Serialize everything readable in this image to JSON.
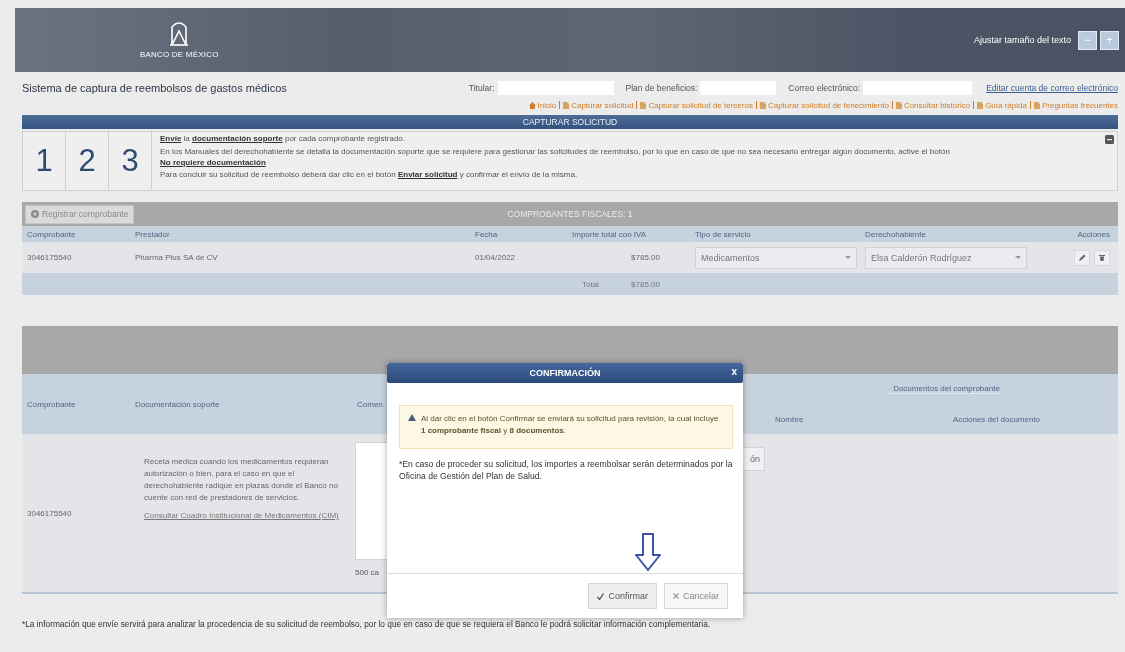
{
  "header": {
    "logo_text": "BANCO DE MÉXICO",
    "text_size_label": "Ajustar tamaño del texto",
    "text_size_buttons": [
      "−",
      "+"
    ]
  },
  "app_title": "Sistema de captura de reembolsos de gastos médicos",
  "fields": [
    {
      "label": "Titular:"
    },
    {
      "label": "Plan de beneficios:"
    },
    {
      "label": "Correo electrónico:"
    }
  ],
  "edit_email_link": "Editar cuenta de correo electrónico",
  "nav": [
    "Inicio",
    "Capturar solicitud",
    "Capturar solicitud de terceros",
    "Capturar solicitud de fenecimiento",
    "Consultar histórico",
    "Guía rápida",
    "Preguntas frecuentes"
  ],
  "section_title": "CAPTURAR SOLICITUD",
  "steps": {
    "numbers": [
      "1",
      "2",
      "3"
    ],
    "lines": [
      [
        {
          "text": "Envíe",
          "link": true
        },
        {
          "text": " la ",
          "link": false
        },
        {
          "text": "documentación soporte",
          "link": true
        },
        {
          "text": " por cada comprobante registrado.",
          "link": false
        }
      ],
      [
        {
          "text": "En los Manuales del derechohabiente se detalla la documentación soporte que se requiere para gestionar las solicitudes de reembolso, por lo que en caso de que no sea necesario entregar algún documento, active el botón ",
          "link": false
        },
        {
          "text": "No requiere documentación",
          "link": true
        }
      ],
      [
        {
          "text": "Para concluir su solicitud de reembolso deberá dar clic en el botón ",
          "link": false
        },
        {
          "text": "Enviar solicitud",
          "link": true
        },
        {
          "text": " y confirmar el envío de la misma.",
          "link": false
        }
      ]
    ]
  },
  "receipts": {
    "add_button": "Registrar comprobante",
    "title": "COMPROBANTES FISCALES: 1",
    "columns": [
      "Comprobante",
      "Prestador",
      "Fecha",
      "Importe total con IVA",
      "Tipo de servicio",
      "Derechohabiente",
      "Acciones"
    ],
    "rows": [
      {
        "receipt": "3046175540",
        "provider": "Pharma Plus SA de CV",
        "date": "01/04/2022",
        "amount": "$785.00",
        "service_type": "Medicamentos",
        "beneficiary": "Elsa Calderón Rodríguez"
      }
    ],
    "total_label": "Total",
    "total": "$785.00"
  },
  "documents": {
    "columns": [
      "Comprobante",
      "Documentación soporte",
      "Comen"
    ],
    "group_header": "Documentos del comprobante",
    "subcolumns": [
      "Nombre",
      "Acciones del documento"
    ],
    "rows": [
      {
        "receipt": "3046175540",
        "requirement": "Receta médica cuando los medicamentos requieran autorización o bien, para el caso en que el derechohabiente radique en plazas donde el Banco no cuente con red de prestadores de servicios.",
        "link": "Consultar Cuadro Institucional de Medicamentos (CIM)",
        "char_count": "500 ca",
        "button": "ón"
      }
    ]
  },
  "footnote": "*La información que envíe servirá para analizar la procedencia de su solicitud de reembolso, por lo que en caso de que se requiera el Banco le podrá solicitar información complementaria.",
  "dialog": {
    "title": "CONFIRMACIÓN",
    "close": "x",
    "warning": "Al dar clic en el botón Confirmar se enviará su solicitud para revisión, la cual incluye **1 comprobante fiscal** y **8 documentos**.",
    "note": "*En caso de proceder su solicitud, los importes a reembolsar serán determinados por la Oficina de Gestión del Plan de Salud.",
    "buttons": [
      {
        "label": "Confirmar",
        "kind": "confirm"
      },
      {
        "label": "Cancelar",
        "kind": "cancel"
      }
    ]
  }
}
